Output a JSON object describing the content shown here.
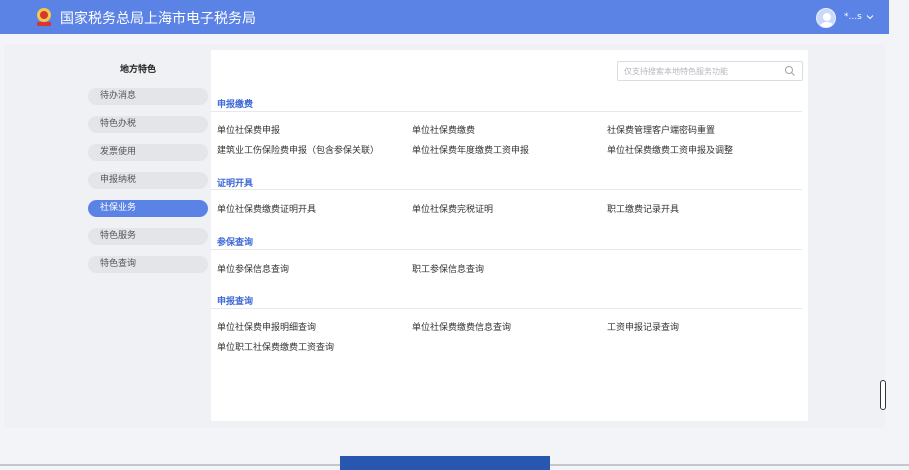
{
  "header": {
    "title": "国家税务总局上海市电子税务局",
    "user_name": "*...s",
    "logo_icon": "tax-emblem",
    "avatar_icon": "user-avatar",
    "accent": "#5b83e6"
  },
  "sidebar": {
    "title": "地方特色",
    "items": [
      {
        "label": "待办消息"
      },
      {
        "label": "特色办税"
      },
      {
        "label": "发票使用"
      },
      {
        "label": "申报纳税"
      },
      {
        "label": "社保业务"
      },
      {
        "label": "特色服务"
      },
      {
        "label": "特色查询"
      }
    ],
    "active": "社保业务"
  },
  "search": {
    "placeholder": "仅支持搜索本地特色服务功能"
  },
  "sections": [
    {
      "title": "申报缴费",
      "links": [
        "单位社保费申报",
        "单位社保费缴费",
        "社保费管理客户端密码重置",
        "建筑业工伤保险费申报（包含参保关联）",
        "单位社保费年度缴费工资申报",
        "单位社保费缴费工资申报及调整"
      ]
    },
    {
      "title": "证明开具",
      "links": [
        "单位社保费缴费证明开具",
        "单位社保费完税证明",
        "职工缴费记录开具"
      ]
    },
    {
      "title": "参保查询",
      "links": [
        "单位参保信息查询",
        "职工参保信息查询"
      ]
    },
    {
      "title": "申报查询",
      "links": [
        "单位社保费申报明细查询",
        "单位社保费缴费信息查询",
        "工资申报记录查询",
        "单位职工社保费缴费工资查询"
      ]
    }
  ]
}
